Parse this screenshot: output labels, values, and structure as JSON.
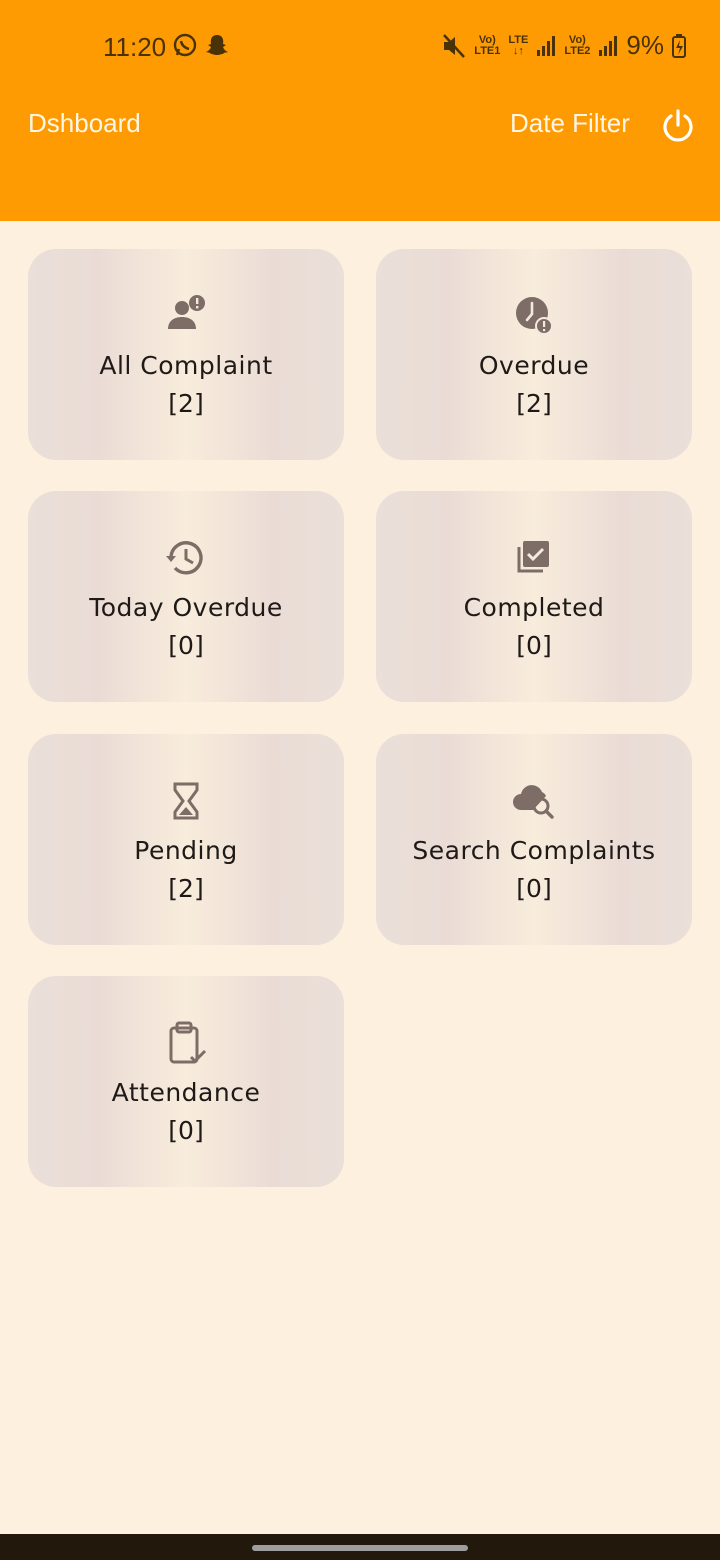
{
  "status_bar": {
    "time": "11:20",
    "sim1": "LTE1",
    "sim2": "LTE2",
    "lte": "LTE",
    "volte": "Vo)",
    "battery": "9%"
  },
  "toolbar": {
    "title": "Dshboard",
    "date_filter": "Date Filter"
  },
  "cards": [
    {
      "label": "All Complaint",
      "count": "[2]",
      "icon": "person-alert-icon"
    },
    {
      "label": "Overdue",
      "count": "[2]",
      "icon": "clock-alert-icon"
    },
    {
      "label": "Today Overdue",
      "count": "[0]",
      "icon": "history-icon"
    },
    {
      "label": "Completed",
      "count": "[0]",
      "icon": "checklist-icon"
    },
    {
      "label": "Pending",
      "count": "[2]",
      "icon": "hourglass-icon"
    },
    {
      "label": "Search Complaints",
      "count": "[0]",
      "icon": "cloud-search-icon"
    },
    {
      "label": "Attendance",
      "count": "[0]",
      "icon": "clipboard-check-icon"
    }
  ],
  "colors": {
    "primary": "#ff9b02",
    "background": "#fdf0df",
    "icon": "#7d6d66"
  }
}
